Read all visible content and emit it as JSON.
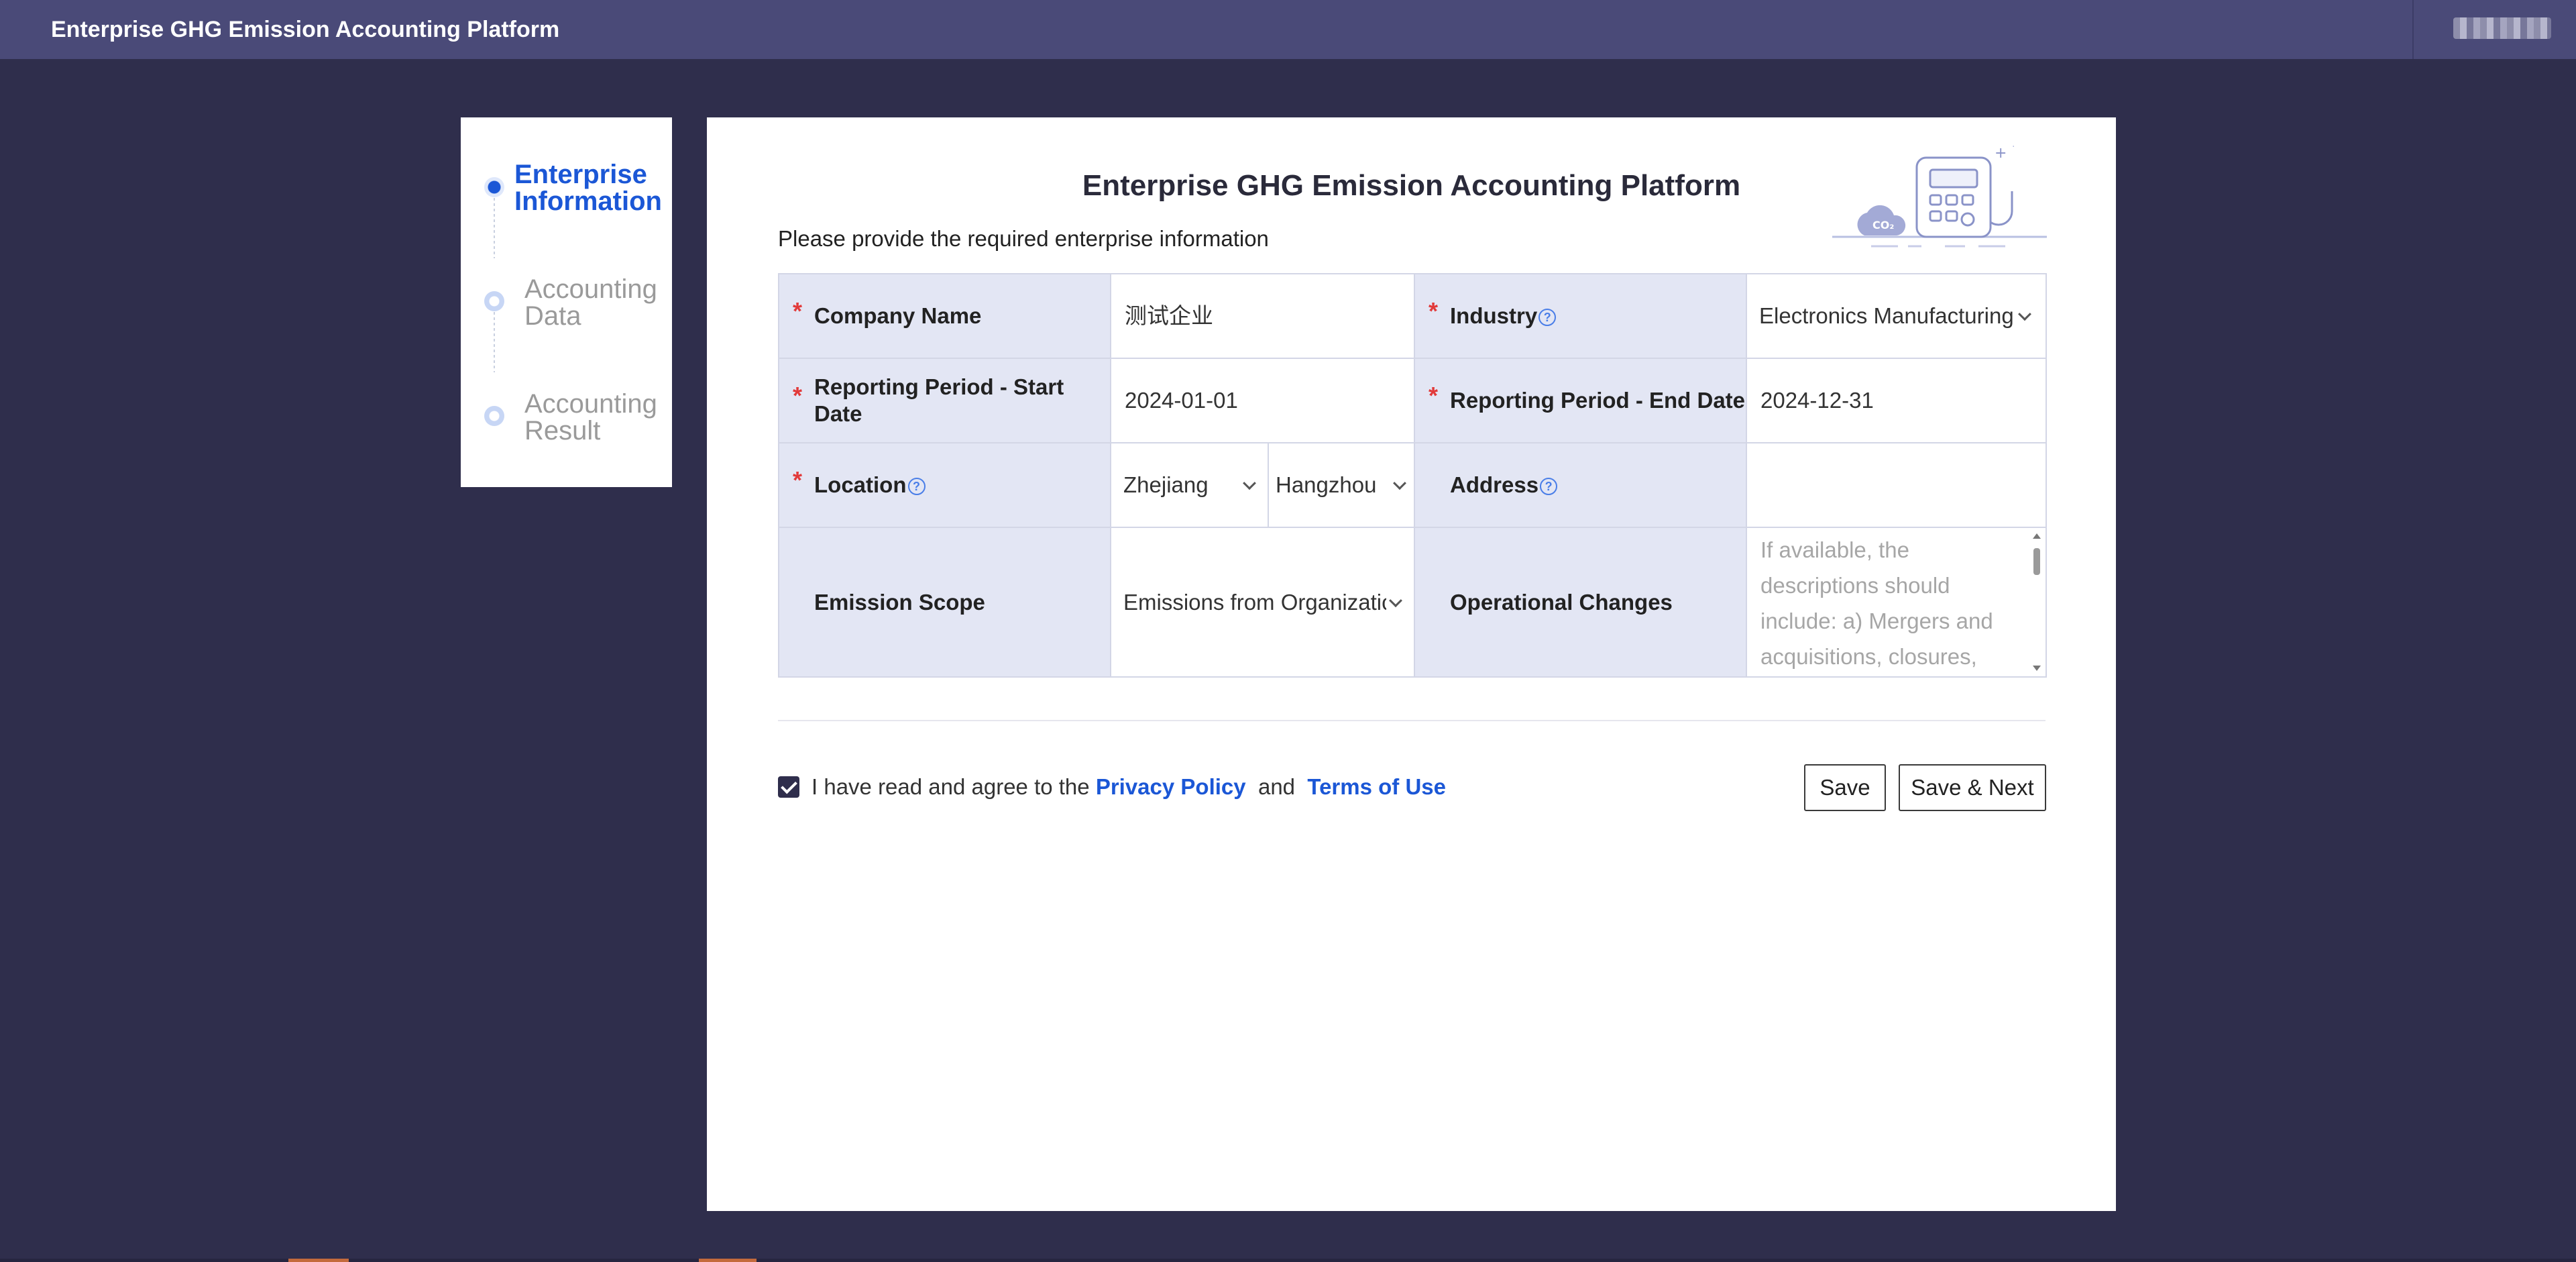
{
  "app": {
    "title": "Enterprise GHG Emission Accounting Platform"
  },
  "steps": [
    {
      "label_line1": "Enterprise",
      "label_line2": "Information",
      "state": "active"
    },
    {
      "label_line1": "Accounting",
      "label_line2": "Data",
      "state": "pending"
    },
    {
      "label_line1": "Accounting",
      "label_line2": "Result",
      "state": "pending"
    }
  ],
  "card": {
    "title": "Enterprise GHG Emission Accounting Platform",
    "subtitle": "Please provide the required enterprise information"
  },
  "form": {
    "company_name": {
      "label": "Company Name",
      "value": "测试企业",
      "required": true
    },
    "industry": {
      "label": "Industry",
      "value": "Electronics Manufacturing",
      "required": true
    },
    "start_date": {
      "label": "Reporting Period - Start Date",
      "value": "2024-01-01",
      "required": true
    },
    "end_date": {
      "label": "Reporting Period - End Date",
      "value": "2024-12-31",
      "required": true
    },
    "location": {
      "label": "Location",
      "province": "Zhejiang",
      "city": "Hangzhou",
      "required": true
    },
    "address": {
      "label": "Address",
      "value": ""
    },
    "emission_scope": {
      "label": "Emission Scope",
      "value": "Emissions from Organizatic"
    },
    "operational_changes": {
      "label": "Operational Changes",
      "placeholder": "If available, the descriptions should include: a) Mergers and acquisitions, closures, relocations; b) Changes in"
    },
    "required_mark": "*",
    "help_glyph": "?"
  },
  "agreement": {
    "checked": true,
    "prefix": "I have read and agree to the ",
    "privacy_link": "Privacy Policy",
    "and": "  and  ",
    "terms_link": "Terms of Use"
  },
  "buttons": {
    "save": "Save",
    "save_next": "Save & Next"
  },
  "colors": {
    "accent": "#1b57d6",
    "background": "#2f2e4c",
    "topbar": "#4a4a78",
    "label_bg": "#e3e6f4",
    "required": "#e23a3a"
  }
}
